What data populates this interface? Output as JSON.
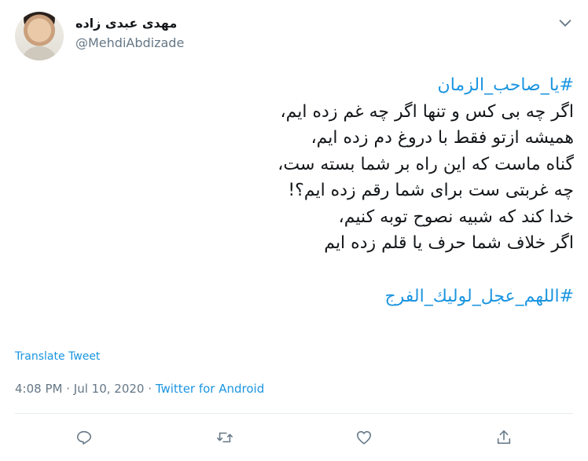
{
  "author": {
    "display_name": "مهدی عبدی زاده",
    "handle": "@MehdiAbdizade"
  },
  "tweet": {
    "hashtag_top": "#یا_صاحب_الزمان",
    "lines": [
      "اگر چه بی کس و تنها اگر چه غم زده ایم،",
      "همیشه ازتو فقط با دروغ دم زده ایم،",
      "گناه ماست که این راه بر شما بسته ست،",
      "چه غربتی ست برای شما رقم زده ایم؟!",
      "خدا کند که شبیه نصوح توبه کنیم،",
      "اگر خلاف شما حرف یا قلم زده ایم"
    ],
    "hashtag_bottom": "#اللهم_عجل_لوليك_الفرج"
  },
  "translate_label": "Translate Tweet",
  "meta": {
    "time": "4:08 PM",
    "separator": "·",
    "date": "Jul 10, 2020",
    "source": "Twitter for Android"
  },
  "icons": {
    "caret": "chevron-down-icon",
    "reply": "reply-icon",
    "retweet": "retweet-icon",
    "like": "heart-icon",
    "share": "share-icon"
  },
  "colors": {
    "accent": "#1b95e0",
    "text": "#14171a",
    "secondary": "#657786",
    "divider": "#e6ecf0"
  }
}
